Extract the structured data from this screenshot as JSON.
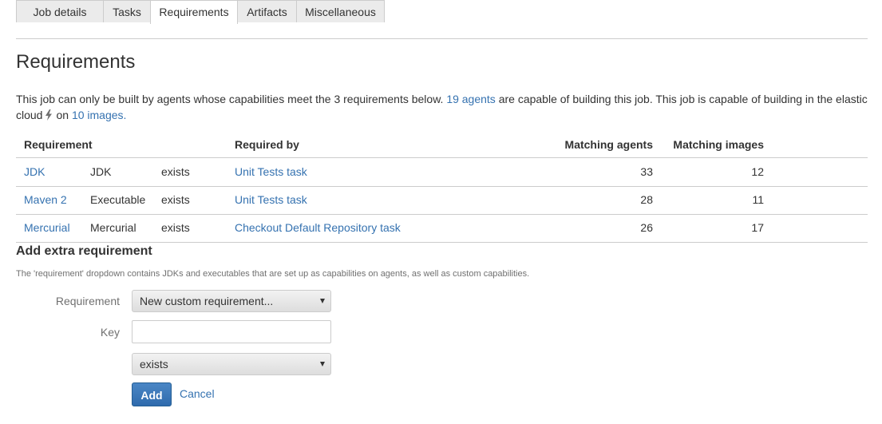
{
  "tabs": [
    {
      "label": "Job details",
      "active": false
    },
    {
      "label": "Tasks",
      "active": false
    },
    {
      "label": "Requirements",
      "active": true
    },
    {
      "label": "Artifacts",
      "active": false
    },
    {
      "label": "Miscellaneous",
      "active": false
    }
  ],
  "page_title": "Requirements",
  "intro": {
    "text1": "This job can only be built by agents whose capabilities meet the 3 requirements below.",
    "agents_link": "19 agents",
    "text2": "are capable of building this job. This job is capable of building in the elastic cloud",
    "text3": "on",
    "images_link": "10 images.",
    "bolt_icon": "lightning-bolt-icon"
  },
  "table": {
    "headers": {
      "requirement": "Requirement",
      "required_by": "Required by",
      "matching_agents": "Matching agents",
      "matching_images": "Matching images"
    },
    "rows": [
      {
        "requirement": "JDK",
        "key": "JDK",
        "match": "exists",
        "required_by": "Unit Tests task",
        "agents": "33",
        "images": "12"
      },
      {
        "requirement": "Maven 2",
        "key": "Executable",
        "match": "exists",
        "required_by": "Unit Tests task",
        "agents": "28",
        "images": "11"
      },
      {
        "requirement": "Mercurial",
        "key": "Mercurial",
        "match": "exists",
        "required_by": "Checkout Default Repository task",
        "agents": "26",
        "images": "17"
      }
    ]
  },
  "add_section": {
    "title": "Add extra requirement",
    "help": "The 'requirement' dropdown contains JDKs and executables that are set up as capabilities on agents, as well as custom capabilities.",
    "requirement_label": "Requirement",
    "requirement_value": "New custom requirement...",
    "key_label": "Key",
    "key_value": "",
    "match_value": "exists",
    "add_button": "Add",
    "cancel_link": "Cancel"
  },
  "colors": {
    "link": "#3572b0",
    "primary_button": "#3572b0",
    "border": "#cccccc"
  }
}
